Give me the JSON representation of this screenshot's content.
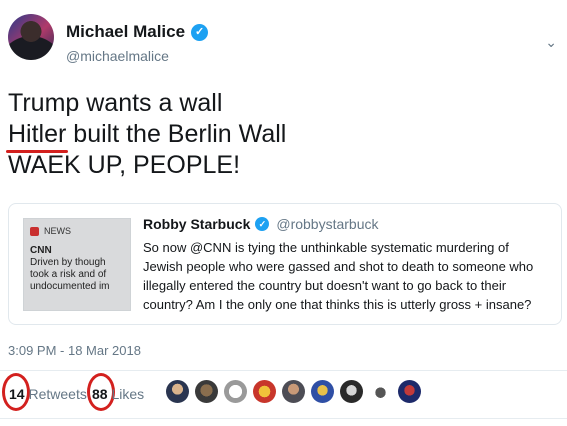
{
  "author": {
    "name": "Michael Malice",
    "handle": "@michaelmalice",
    "verified_icon": "check-icon"
  },
  "tweet": {
    "lines": [
      "Trump wants a wall",
      "Hitler",
      " built the Berlin Wall",
      "WAEK UP, PEOPLE!"
    ]
  },
  "quoted": {
    "name": "Robby Starbuck",
    "handle": "@robbystarbuck",
    "text_lines": [
      "So now @CNN is tying the unthinkable systematic murdering of",
      "Jewish people who were gassed and shot to death to someone who",
      "illegally entered the country but doesn't want to go back to their",
      "country? Am I the only one that thinks this is utterly gross + insane?"
    ],
    "thumb": {
      "header": "NEWS",
      "source": "CNN",
      "lines": [
        "Driven by though",
        "took a risk and of",
        "undocumented im"
      ]
    }
  },
  "timestamp": "3:09 PM - 18 Mar 2018",
  "stats": {
    "retweets_count": "14",
    "retweets_label": "Retweets",
    "likes_count": "88",
    "likes_label": "Likes"
  },
  "colors": {
    "link": "#1da1f2",
    "annotation": "#d3201e",
    "muted": "#657786"
  }
}
